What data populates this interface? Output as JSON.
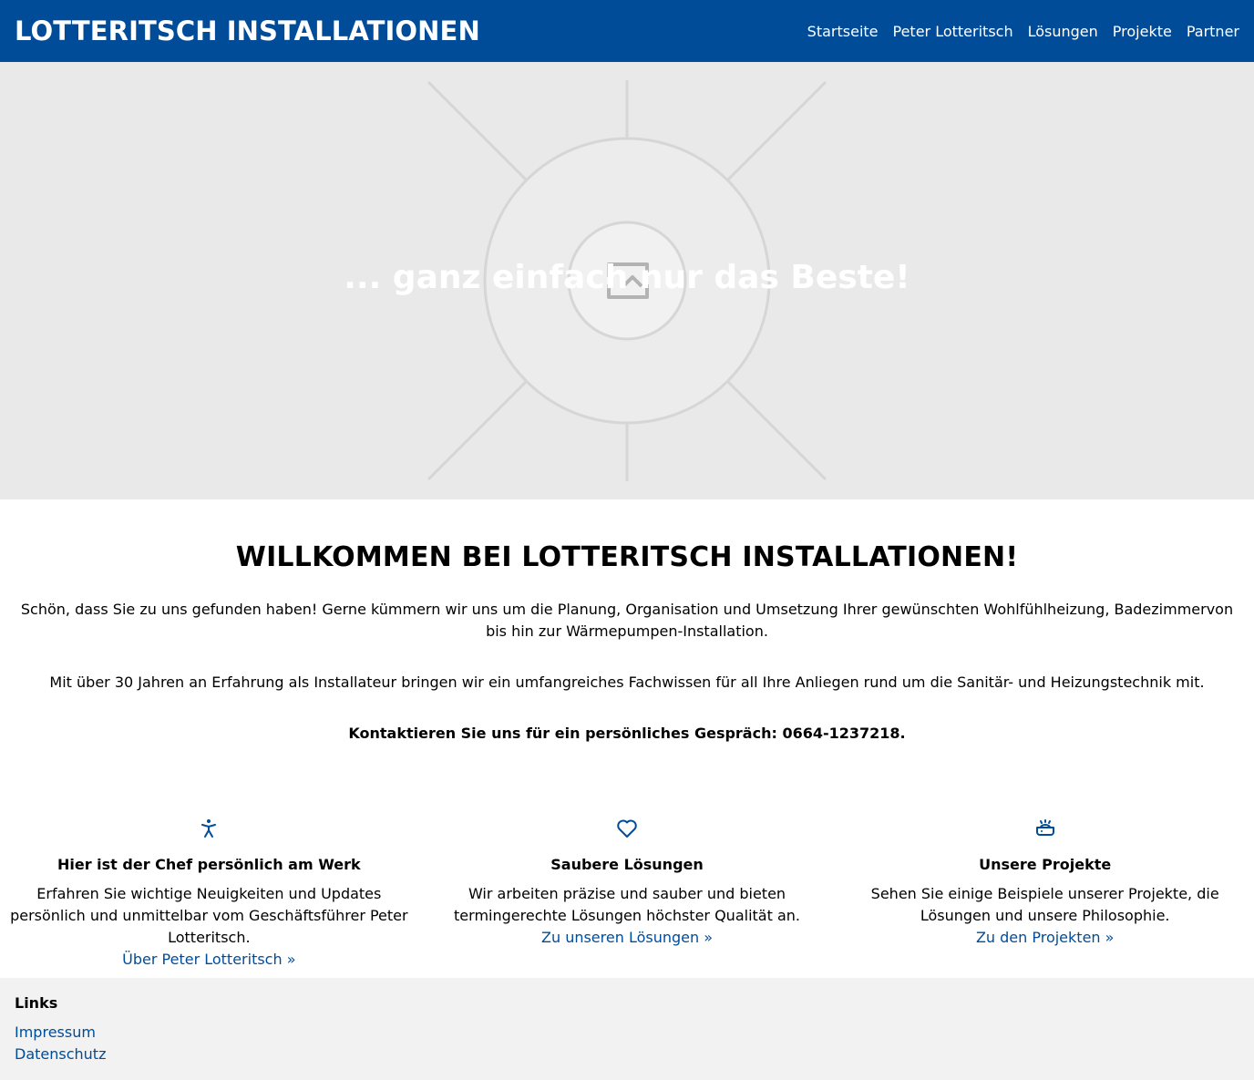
{
  "header": {
    "brand": "LOTTERITSCH INSTALLATIONEN",
    "nav": [
      "Startseite",
      "Peter Lotteritsch",
      "Lösungen",
      "Projekte",
      "Partner"
    ]
  },
  "hero": {
    "title": "... ganz einfach nur das Beste!",
    "image_icon": "broken-image-icon"
  },
  "welcome": {
    "heading": "WILLKOMMEN BEI LOTTERITSCH INSTALLATIONEN!",
    "paragraph1": "Schön, dass Sie zu uns gefunden haben! Gerne kümmern wir uns um die Planung, Organisation und Umsetzung Ihrer gewünschten Wohlfühlheizung, Badezimmervon bis hin zur Wärmepumpen-Installation.",
    "paragraph2": "Mit über 30 Jahren an Erfahrung als Installateur bringen wir ein umfangreiches Fachwissen für all Ihre Anliegen rund um die Sanitär- und Heizungstechnik mit.",
    "contact": "Kontaktieren Sie uns für ein persönliches Gespräch: 0664-1237218."
  },
  "features": [
    {
      "icon": "accessibility-person-icon",
      "title": "Hier ist der Chef persönlich am Werk",
      "text": "Erfahren Sie wichtige Neuigkeiten und Updates persönlich und unmittelbar vom Geschäftsführer Peter Lotteritsch.",
      "link": "Über Peter Lotteritsch »"
    },
    {
      "icon": "heart-icon",
      "title": "Saubere Lösungen",
      "text": "Wir arbeiten präzise und sauber und bieten termingerechte Lösungen höchster Qualität an.",
      "link": "Zu unseren Lösungen »"
    },
    {
      "icon": "bathtub-icon",
      "title": "Unsere Projekte",
      "text": "Sehen Sie einige Beispiele unserer Projekte, die Lösungen und unsere Philosophie.",
      "link": "Zu den Projekten »"
    }
  ],
  "footer": {
    "heading": "Links",
    "links": [
      "Impressum",
      "Datenschutz"
    ]
  },
  "colors": {
    "primary": "#004c99",
    "hero_bg": "#e9e9e9",
    "footer_bg": "#f2f2f2"
  }
}
